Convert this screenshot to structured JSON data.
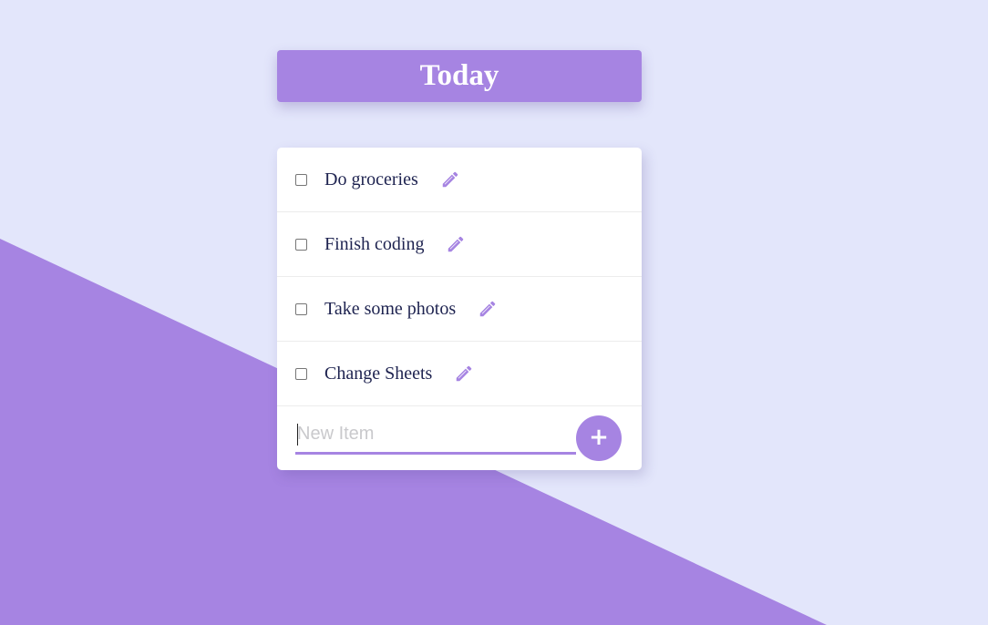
{
  "colors": {
    "background": "#E3E6FB",
    "accent": "#A684E2",
    "text": "#1E2350",
    "card": "#FFFFFF"
  },
  "heading": {
    "title": "Today"
  },
  "todo_list": {
    "items": [
      {
        "label": "Do groceries",
        "checked": false,
        "edit_icon": "pencil-icon"
      },
      {
        "label": "Finish coding",
        "checked": false,
        "edit_icon": "pencil-icon"
      },
      {
        "label": "Take some photos",
        "checked": false,
        "edit_icon": "pencil-icon"
      },
      {
        "label": "Change Sheets",
        "checked": false,
        "edit_icon": "pencil-icon"
      }
    ]
  },
  "new_item": {
    "value": "",
    "placeholder": "New Item",
    "add_label": "+"
  }
}
